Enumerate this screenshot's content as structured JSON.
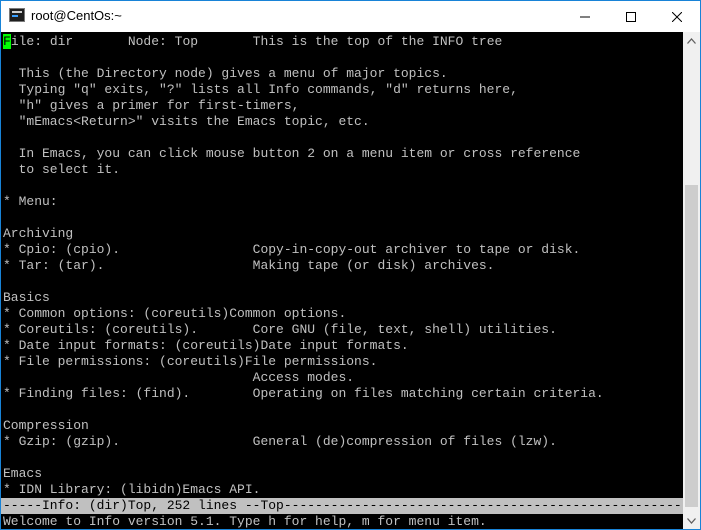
{
  "window": {
    "title": "root@CentOs:~"
  },
  "terminal": {
    "cursor_char": "F",
    "header_rest": "ile: dir       Node: Top       This is the top of the INFO tree",
    "lines": [
      "",
      "  This (the Directory node) gives a menu of major topics.",
      "  Typing \"q\" exits, \"?\" lists all Info commands, \"d\" returns here,",
      "  \"h\" gives a primer for first-timers,",
      "  \"mEmacs<Return>\" visits the Emacs topic, etc.",
      "",
      "  In Emacs, you can click mouse button 2 on a menu item or cross reference",
      "  to select it.",
      "",
      "* Menu:",
      "",
      "Archiving",
      "* Cpio: (cpio).                 Copy-in-copy-out archiver to tape or disk.",
      "* Tar: (tar).                   Making tape (or disk) archives.",
      "",
      "Basics",
      "* Common options: (coreutils)Common options.",
      "* Coreutils: (coreutils).       Core GNU (file, text, shell) utilities.",
      "* Date input formats: (coreutils)Date input formats.",
      "* File permissions: (coreutils)File permissions.",
      "                                Access modes.",
      "* Finding files: (find).        Operating on files matching certain criteria.",
      "",
      "Compression",
      "* Gzip: (gzip).                 General (de)compression of files (lzw).",
      "",
      "Emacs",
      "* IDN Library: (libidn)Emacs API."
    ],
    "mode_line": "-----Info: (dir)Top, 252 lines --Top-------------------------------------------------------",
    "echo_line": "Welcome to Info version 5.1. Type h for help, m for menu item."
  },
  "colors": {
    "cursor": "#00ff00",
    "text": "#c0c0c0",
    "background": "#000000",
    "mode_line_bg": "#c0c0c0"
  }
}
